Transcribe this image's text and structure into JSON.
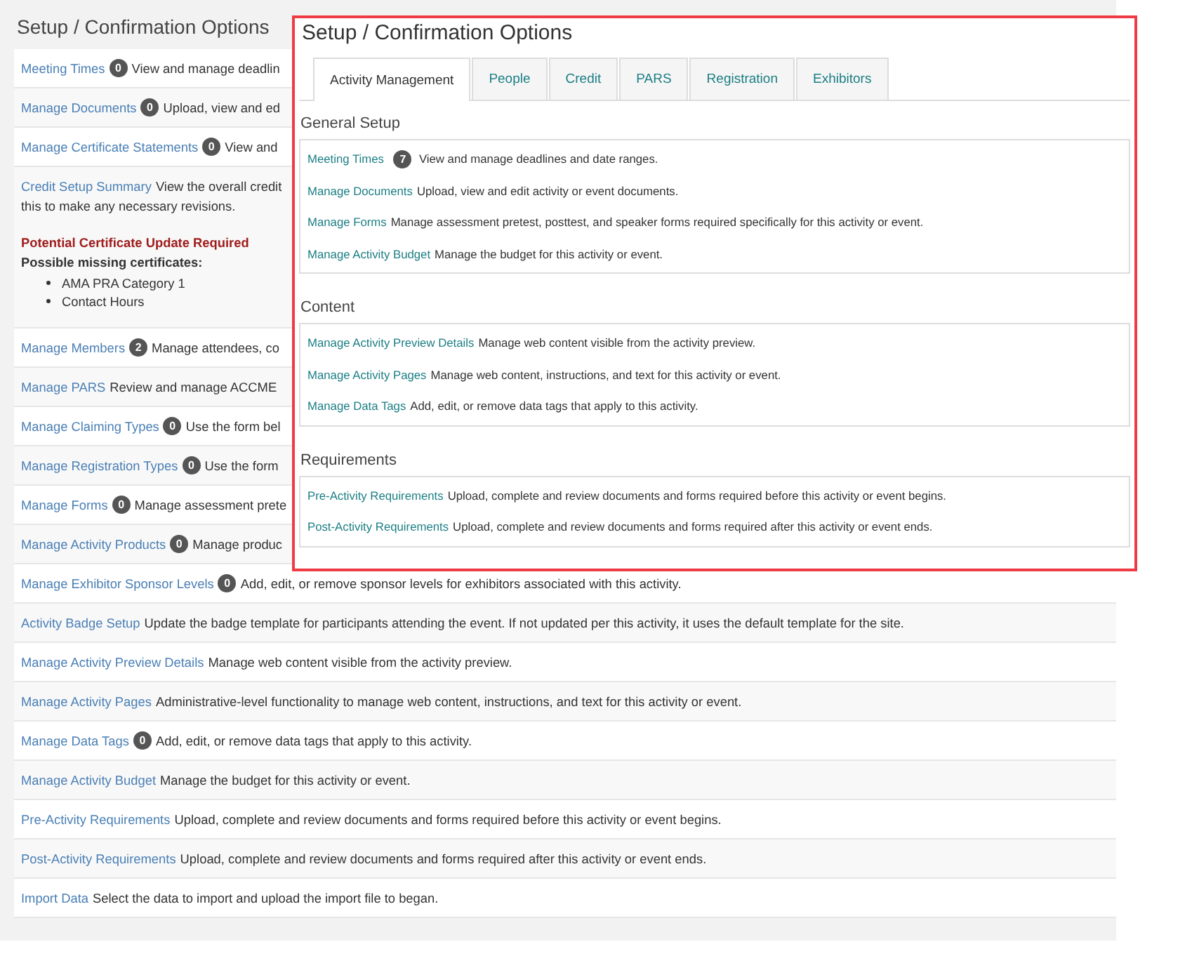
{
  "background_page": {
    "title": "Setup / Confirmation Options",
    "items": [
      {
        "link": "Meeting Times",
        "badge": "0",
        "description": "View and manage deadlin"
      },
      {
        "link": "Manage Documents",
        "badge": "0",
        "description": "Upload, view and ed"
      },
      {
        "link": "Manage Certificate Statements",
        "badge": "0",
        "description": "View and"
      },
      {
        "link": "Credit Setup Summary",
        "description": "View the overall credit",
        "description_2": "this to make any necessary revisions.",
        "warning": {
          "title": "Potential Certificate Update Required",
          "subtitle": "Possible missing certificates:",
          "items": [
            "AMA PRA Category 1",
            "Contact Hours"
          ]
        }
      },
      {
        "link": "Manage Members",
        "badge": "2",
        "description": "Manage attendees, co"
      },
      {
        "link": "Manage PARS",
        "description": "Review and manage ACCME"
      },
      {
        "link": "Manage Claiming Types",
        "badge": "0",
        "description": "Use the form bel"
      },
      {
        "link": "Manage Registration Types",
        "badge": "0",
        "description": "Use the form"
      },
      {
        "link": "Manage Forms",
        "badge": "0",
        "description": "Manage assessment prete"
      },
      {
        "link": "Manage Activity Products",
        "badge": "0",
        "description": "Manage produc"
      },
      {
        "link": "Manage Exhibitor Sponsor Levels",
        "badge": "0",
        "description": "Add, edit, or remove sponsor levels for exhibitors associated with this activity."
      },
      {
        "link": "Activity Badge Setup",
        "description": "Update the badge template for participants attending the event. If not updated per this activity, it uses the default template for the site."
      },
      {
        "link": "Manage Activity Preview Details",
        "description": "Manage web content visible from the activity preview."
      },
      {
        "link": "Manage Activity Pages",
        "description": "Administrative-level functionality to manage web content, instructions, and text for this activity or event."
      },
      {
        "link": "Manage Data Tags",
        "badge": "0",
        "description": "Add, edit, or remove data tags that apply to this activity."
      },
      {
        "link": "Manage Activity Budget",
        "description": "Manage the budget for this activity or event."
      },
      {
        "link": "Pre-Activity Requirements",
        "description": "Upload, complete and review documents and forms required before this activity or event begins."
      },
      {
        "link": "Post-Activity Requirements",
        "description": "Upload, complete and review documents and forms required after this activity or event ends."
      },
      {
        "link": "Import Data",
        "description": "Select the data to import and upload the import file to began."
      }
    ]
  },
  "overlay": {
    "title": "Setup / Confirmation Options",
    "tabs": [
      {
        "label": "Activity Management",
        "selected": true
      },
      {
        "label": "People",
        "selected": false
      },
      {
        "label": "Credit",
        "selected": false
      },
      {
        "label": "PARS",
        "selected": false
      },
      {
        "label": "Registration",
        "selected": false
      },
      {
        "label": "Exhibitors",
        "selected": false
      }
    ],
    "sections": [
      {
        "heading": "General Setup",
        "items": [
          {
            "link": "Meeting Times",
            "badge": "7",
            "description": "View and manage deadlines and date ranges."
          },
          {
            "link": "Manage Documents",
            "description": "Upload, view and edit activity or event documents."
          },
          {
            "link": "Manage Forms",
            "description": "Manage assessment pretest, posttest, and speaker forms required specifically for this activity or event."
          },
          {
            "link": "Manage Activity Budget",
            "description": "Manage the budget for this activity or event."
          }
        ]
      },
      {
        "heading": "Content",
        "items": [
          {
            "link": "Manage Activity Preview Details",
            "description": "Manage web content visible from the activity preview."
          },
          {
            "link": "Manage Activity Pages",
            "description": "Manage web content, instructions, and text for this activity or event."
          },
          {
            "link": "Manage Data Tags",
            "description": "Add, edit, or remove data tags that apply to this activity."
          }
        ]
      },
      {
        "heading": "Requirements",
        "items": [
          {
            "link": "Pre-Activity Requirements",
            "description": "Upload, complete and review documents and forms required before this activity or event begins."
          },
          {
            "link": "Post-Activity Requirements",
            "description": "Upload, complete and review documents and forms required after this activity or event ends."
          }
        ]
      }
    ]
  }
}
